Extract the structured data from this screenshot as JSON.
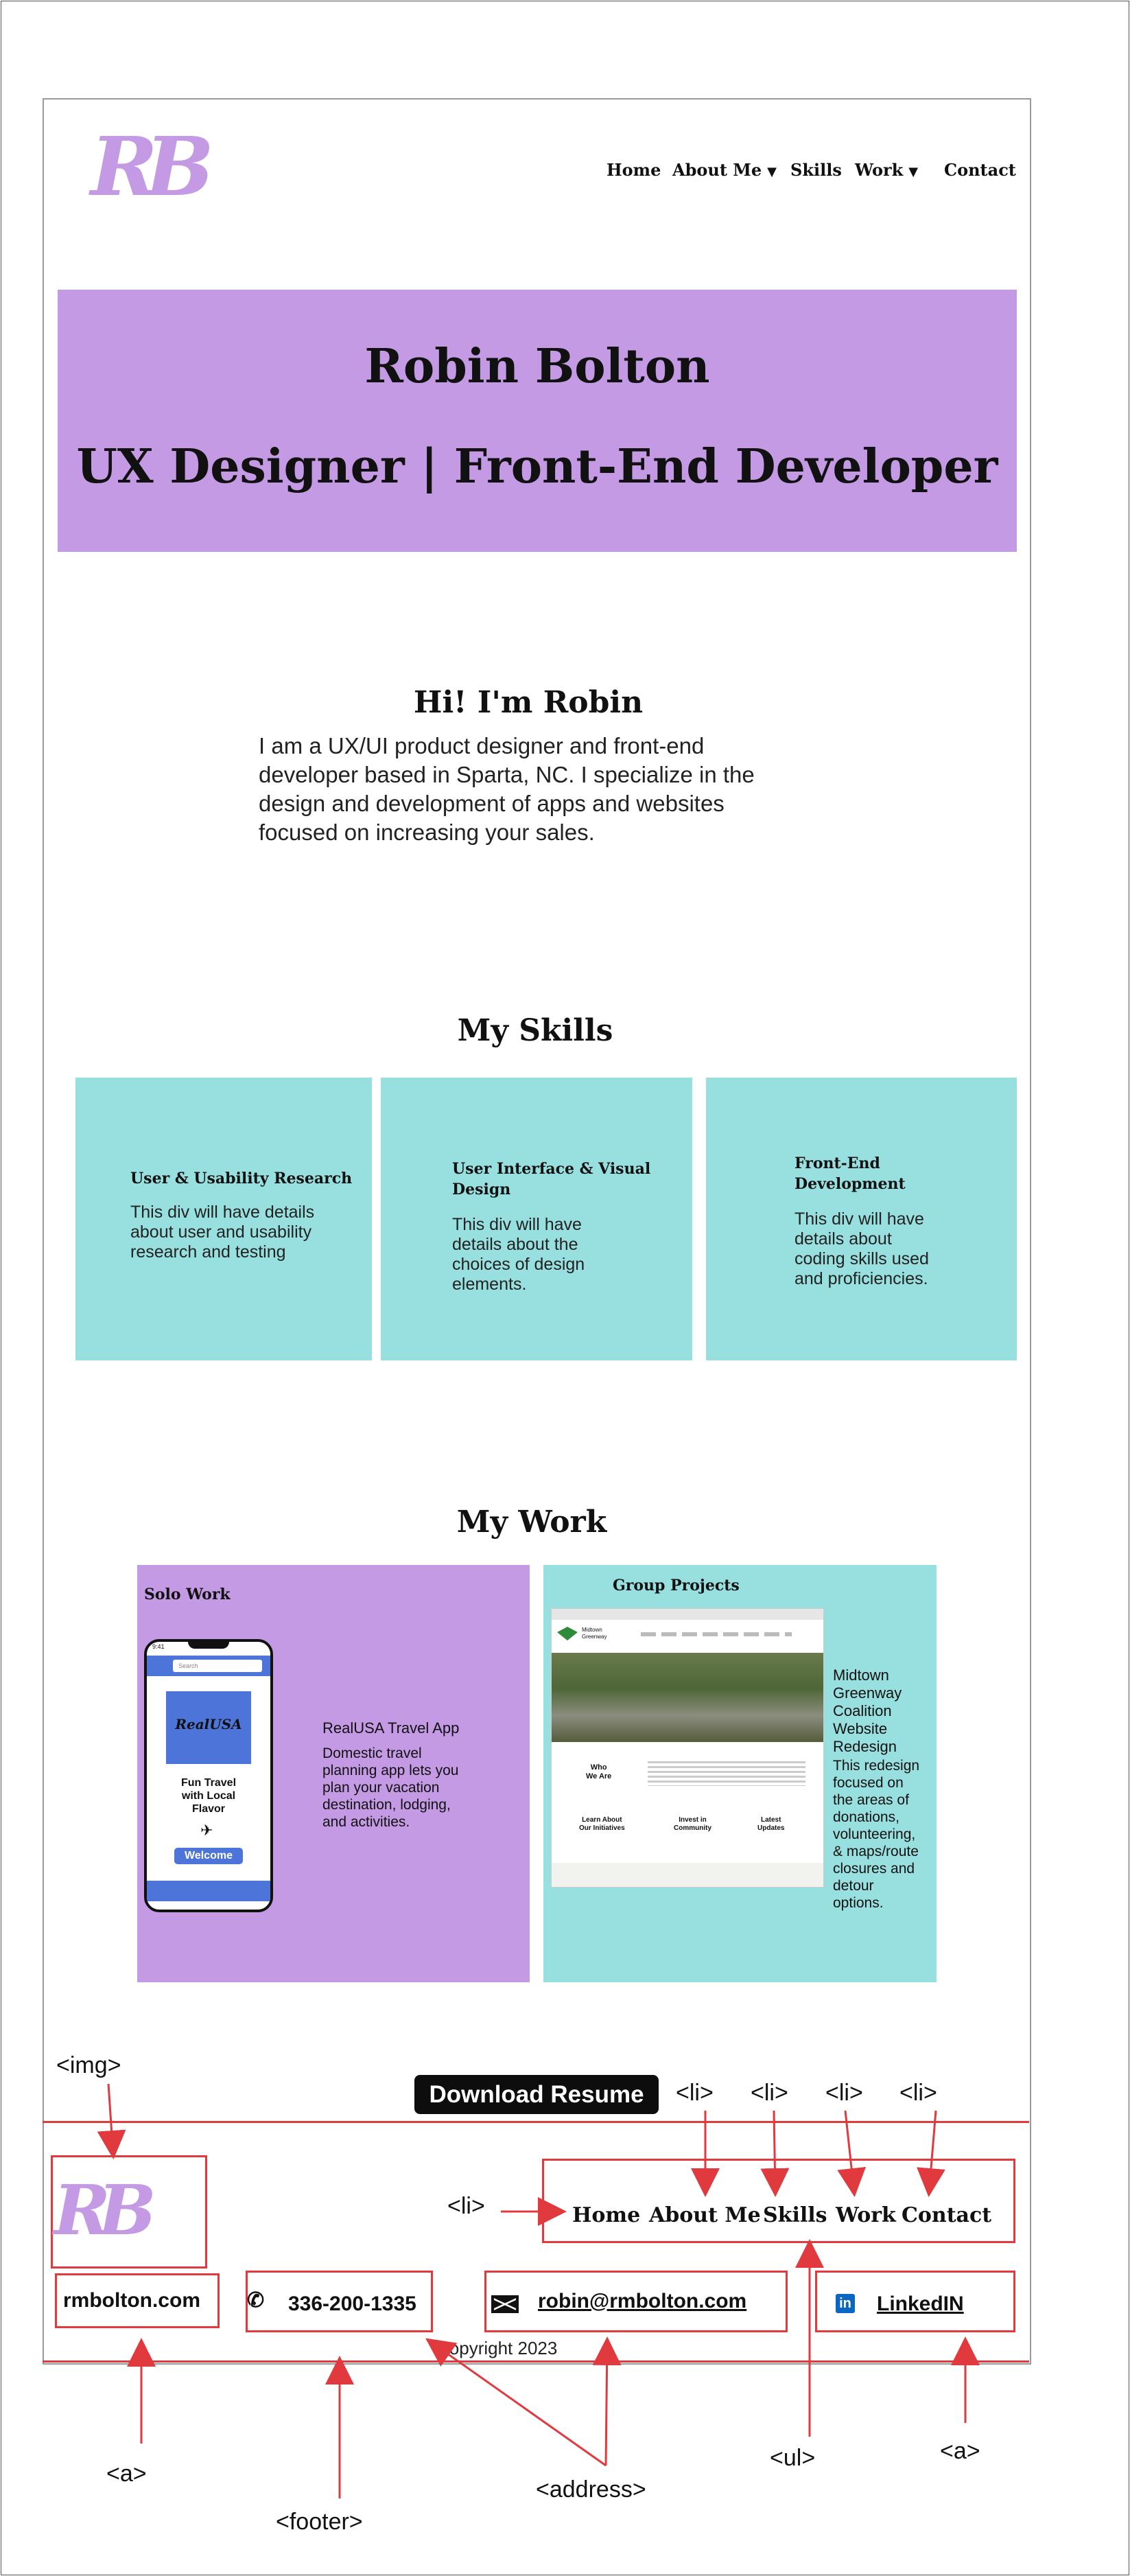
{
  "header": {
    "logo": "RB",
    "nav": [
      {
        "label": "Home",
        "dropdown": false
      },
      {
        "label": "About Me",
        "dropdown": true
      },
      {
        "label": "Skills",
        "dropdown": false
      },
      {
        "label": "Work",
        "dropdown": true
      },
      {
        "label": "Contact",
        "dropdown": false
      }
    ],
    "caret": "▼"
  },
  "hero": {
    "name": "Robin Bolton",
    "tagline": "UX Designer | Front-End Developer"
  },
  "intro": {
    "heading": "Hi! I'm Robin",
    "lines": [
      "I am a UX/UI product designer and front-end",
      "developer based in Sparta, NC. I specialize in the",
      "design and development of apps and websites",
      "focused on increasing your sales."
    ]
  },
  "skills": {
    "heading": "My Skills",
    "cards": [
      {
        "title": [
          "User & Usability Research"
        ],
        "desc": [
          "This div will have details",
          "about user and usability",
          "research and testing"
        ]
      },
      {
        "title": [
          "User Interface & Visual",
          "Design"
        ],
        "desc": [
          "This div will have",
          "details about the",
          "choices of design",
          "elements."
        ]
      },
      {
        "title": [
          "Front-End",
          "Development"
        ],
        "desc": [
          "This div will have",
          "details about",
          "coding skills used",
          "and proficiencies."
        ]
      }
    ]
  },
  "work": {
    "heading": "My Work",
    "solo": {
      "label": "Solo Work",
      "project_title": "RealUSA Travel App",
      "desc": [
        "Domestic travel",
        "planning app lets you",
        "plan your vacation",
        "destination, lodging,",
        "and activities."
      ],
      "phone": {
        "time": "9:41",
        "app_name": "RealUSA",
        "search": "Search",
        "tagline": [
          "Fun Travel",
          "with Local",
          "Flavor"
        ],
        "button": "Welcome"
      }
    },
    "group": {
      "label": "Group Projects",
      "title": [
        "Midtown",
        "Greenway",
        "Coalition",
        "Website",
        "Redesign"
      ],
      "desc": [
        "This redesign",
        "focused on",
        "the areas of",
        "donations,",
        "volunteering,",
        "& maps/route",
        "closures and",
        "detour",
        "options."
      ],
      "screenshot": {
        "site_name": [
          "Midtown",
          "Greenway"
        ],
        "who": [
          "Who",
          "We Are"
        ],
        "cols": [
          [
            "Learn About",
            "Our Initiatives"
          ],
          [
            "Invest in",
            "Community"
          ],
          [
            "Latest",
            "Updates"
          ]
        ]
      }
    }
  },
  "download_label": "Download Resume",
  "footer": {
    "logo": "RB",
    "nav": [
      "Home",
      "About Me",
      "Skills",
      "Work",
      "Contact"
    ],
    "website": "rmbolton.com",
    "phone": "336-200-1335",
    "email": "robin@rmbolton.com",
    "linkedin": "LinkedIN",
    "copyright": "Copyright 2023"
  },
  "annotations": {
    "img": "<img>",
    "li": "<li>",
    "a": "<a>",
    "footer": "<footer>",
    "address": "<address>",
    "ul": "<ul>"
  },
  "colors": {
    "lavender": "#c39ae3",
    "teal": "#98e0df",
    "annotation_red": "#e0393e",
    "button_black": "#0d0d0d"
  }
}
